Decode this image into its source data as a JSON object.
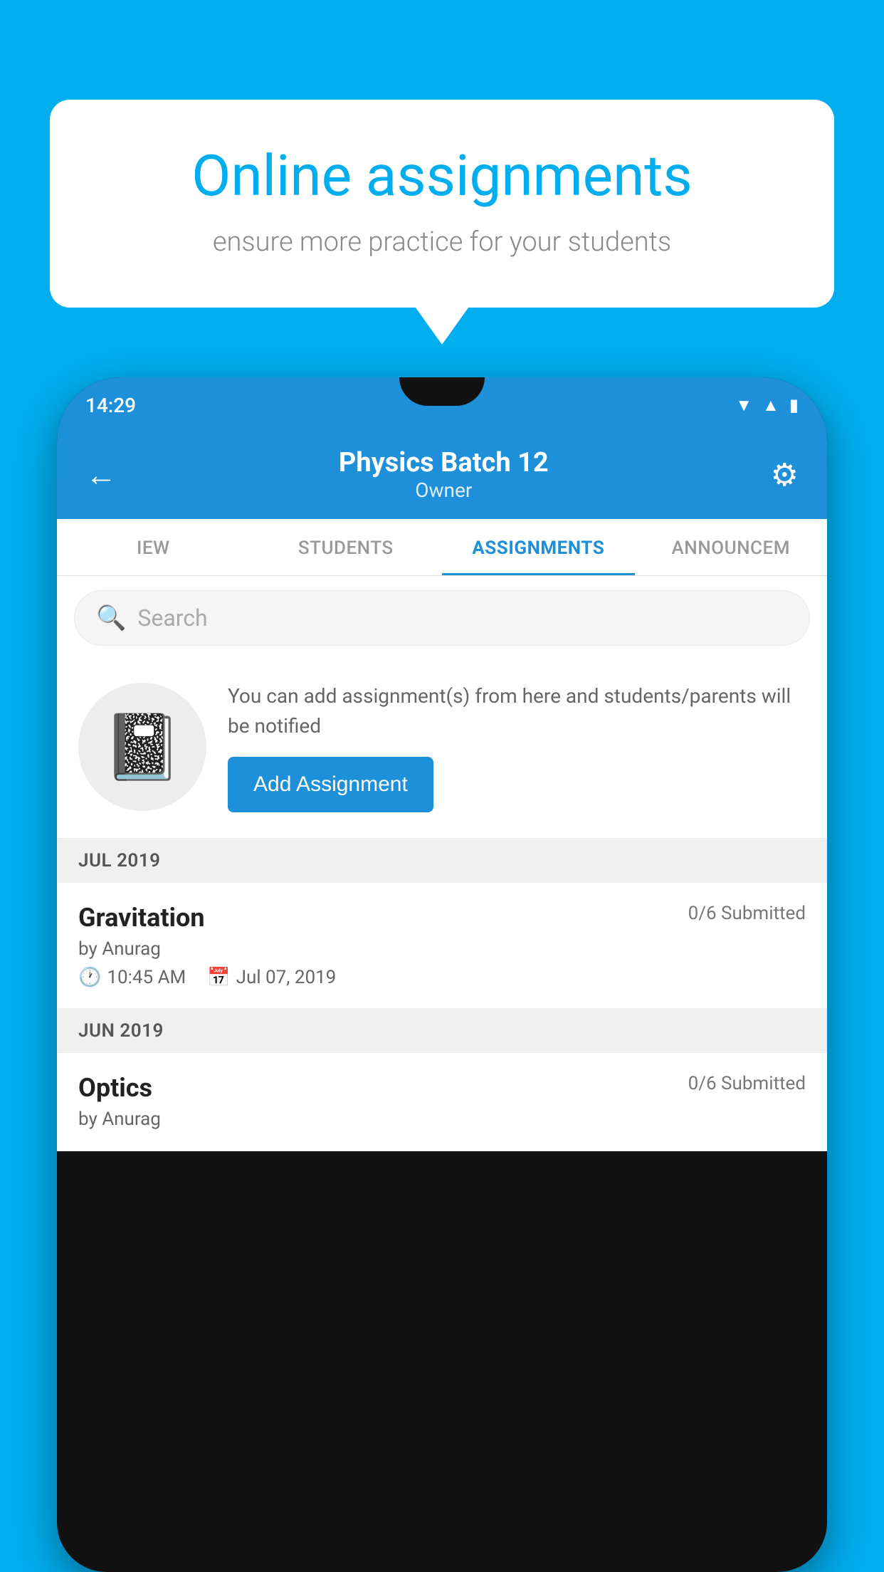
{
  "background_color": "#00AEEF",
  "speech_bubble": {
    "title": "Online assignments",
    "subtitle": "ensure more practice for your students"
  },
  "phone": {
    "status_bar": {
      "time": "14:29",
      "icons": [
        "wifi",
        "signal",
        "battery"
      ]
    },
    "header": {
      "title": "Physics Batch 12",
      "subtitle": "Owner",
      "back_label": "←",
      "settings_label": "⚙"
    },
    "tabs": [
      {
        "label": "IEW",
        "active": false
      },
      {
        "label": "STUDENTS",
        "active": false
      },
      {
        "label": "ASSIGNMENTS",
        "active": true
      },
      {
        "label": "ANNOUNCEM",
        "active": false
      }
    ],
    "search": {
      "placeholder": "Search"
    },
    "promo": {
      "description": "You can add assignment(s) from here and students/parents will be notified",
      "button_label": "Add Assignment"
    },
    "sections": [
      {
        "month": "JUL 2019",
        "assignments": [
          {
            "title": "Gravitation",
            "submitted": "0/6 Submitted",
            "author": "by Anurag",
            "time": "10:45 AM",
            "date": "Jul 07, 2019"
          }
        ]
      },
      {
        "month": "JUN 2019",
        "assignments": [
          {
            "title": "Optics",
            "submitted": "0/6 Submitted",
            "author": "by Anurag"
          }
        ]
      }
    ]
  }
}
